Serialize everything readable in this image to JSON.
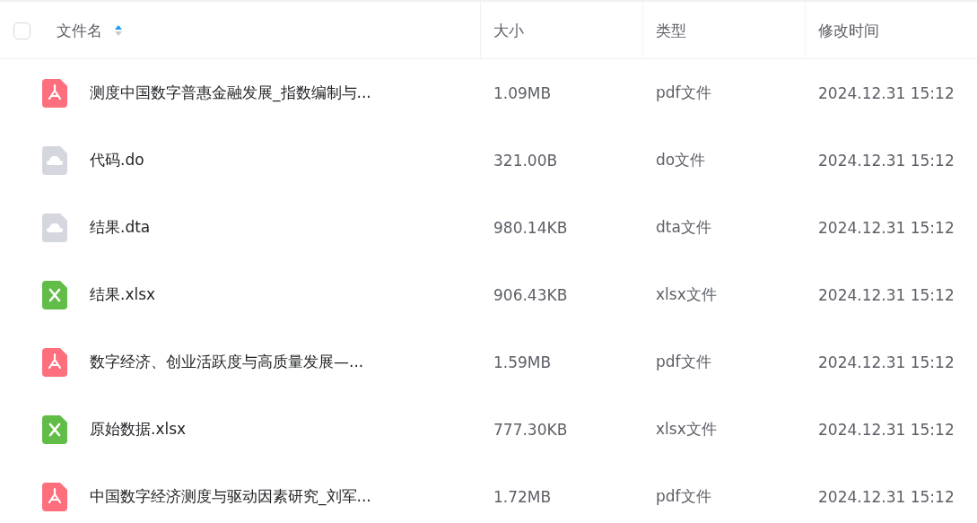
{
  "header": {
    "select_all": {
      "checked": false
    },
    "columns": [
      {
        "label": "文件名",
        "sorted": true,
        "ascending": true
      },
      {
        "label": "大小"
      },
      {
        "label": "类型"
      },
      {
        "label": "修改时间"
      }
    ]
  },
  "files": [
    {
      "kind": "pdf",
      "name": "测度中国数字普惠金融发展_指数编制与...",
      "size": "1.09MB",
      "type": "pdf文件",
      "modified": "2024.12.31 15:12"
    },
    {
      "kind": "other",
      "name": "代码.do",
      "size": "321.00B",
      "type": "do文件",
      "modified": "2024.12.31 15:12"
    },
    {
      "kind": "other",
      "name": "结果.dta",
      "size": "980.14KB",
      "type": "dta文件",
      "modified": "2024.12.31 15:12"
    },
    {
      "kind": "xlsx",
      "name": "结果.xlsx",
      "size": "906.43KB",
      "type": "xlsx文件",
      "modified": "2024.12.31 15:12"
    },
    {
      "kind": "pdf",
      "name": "数字经济、创业活跃度与高质量发展—...",
      "size": "1.59MB",
      "type": "pdf文件",
      "modified": "2024.12.31 15:12"
    },
    {
      "kind": "xlsx",
      "name": "原始数据.xlsx",
      "size": "777.30KB",
      "type": "xlsx文件",
      "modified": "2024.12.31 15:12"
    },
    {
      "kind": "pdf",
      "name": "中国数字经济测度与驱动因素研究_刘军...",
      "size": "1.72MB",
      "type": "pdf文件",
      "modified": "2024.12.31 15:12"
    }
  ]
}
